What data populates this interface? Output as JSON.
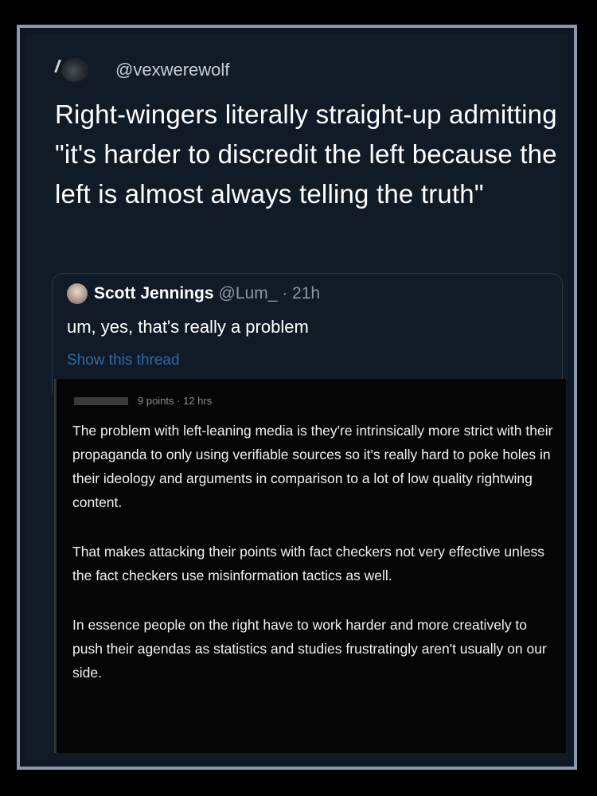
{
  "tweet": {
    "handle": "@vexwerewolf",
    "text": "Right-wingers literally straight-up admitting \"it's harder to discredit the left because the left is almost always telling the truth\""
  },
  "quoted": {
    "name": "Scott Jennings",
    "meta": "@Lum_ · 21h",
    "text": "um, yes, that's really a problem",
    "link": "Show this thread"
  },
  "comment": {
    "meta": "9 points · 12 hrs",
    "paragraphs": [
      "The problem with left-leaning media is they're intrinsically more strict with their propaganda to only using verifiable sources so it's really hard to poke holes in their ideology and arguments in comparison to a lot of low quality rightwing content.",
      "That makes attacking their points with fact checkers not very effective unless the fact checkers use misinformation tactics as well.",
      "In essence people on the right have to work harder and more creatively to push their agendas as statistics and studies frustratingly aren't usually on our side."
    ]
  }
}
